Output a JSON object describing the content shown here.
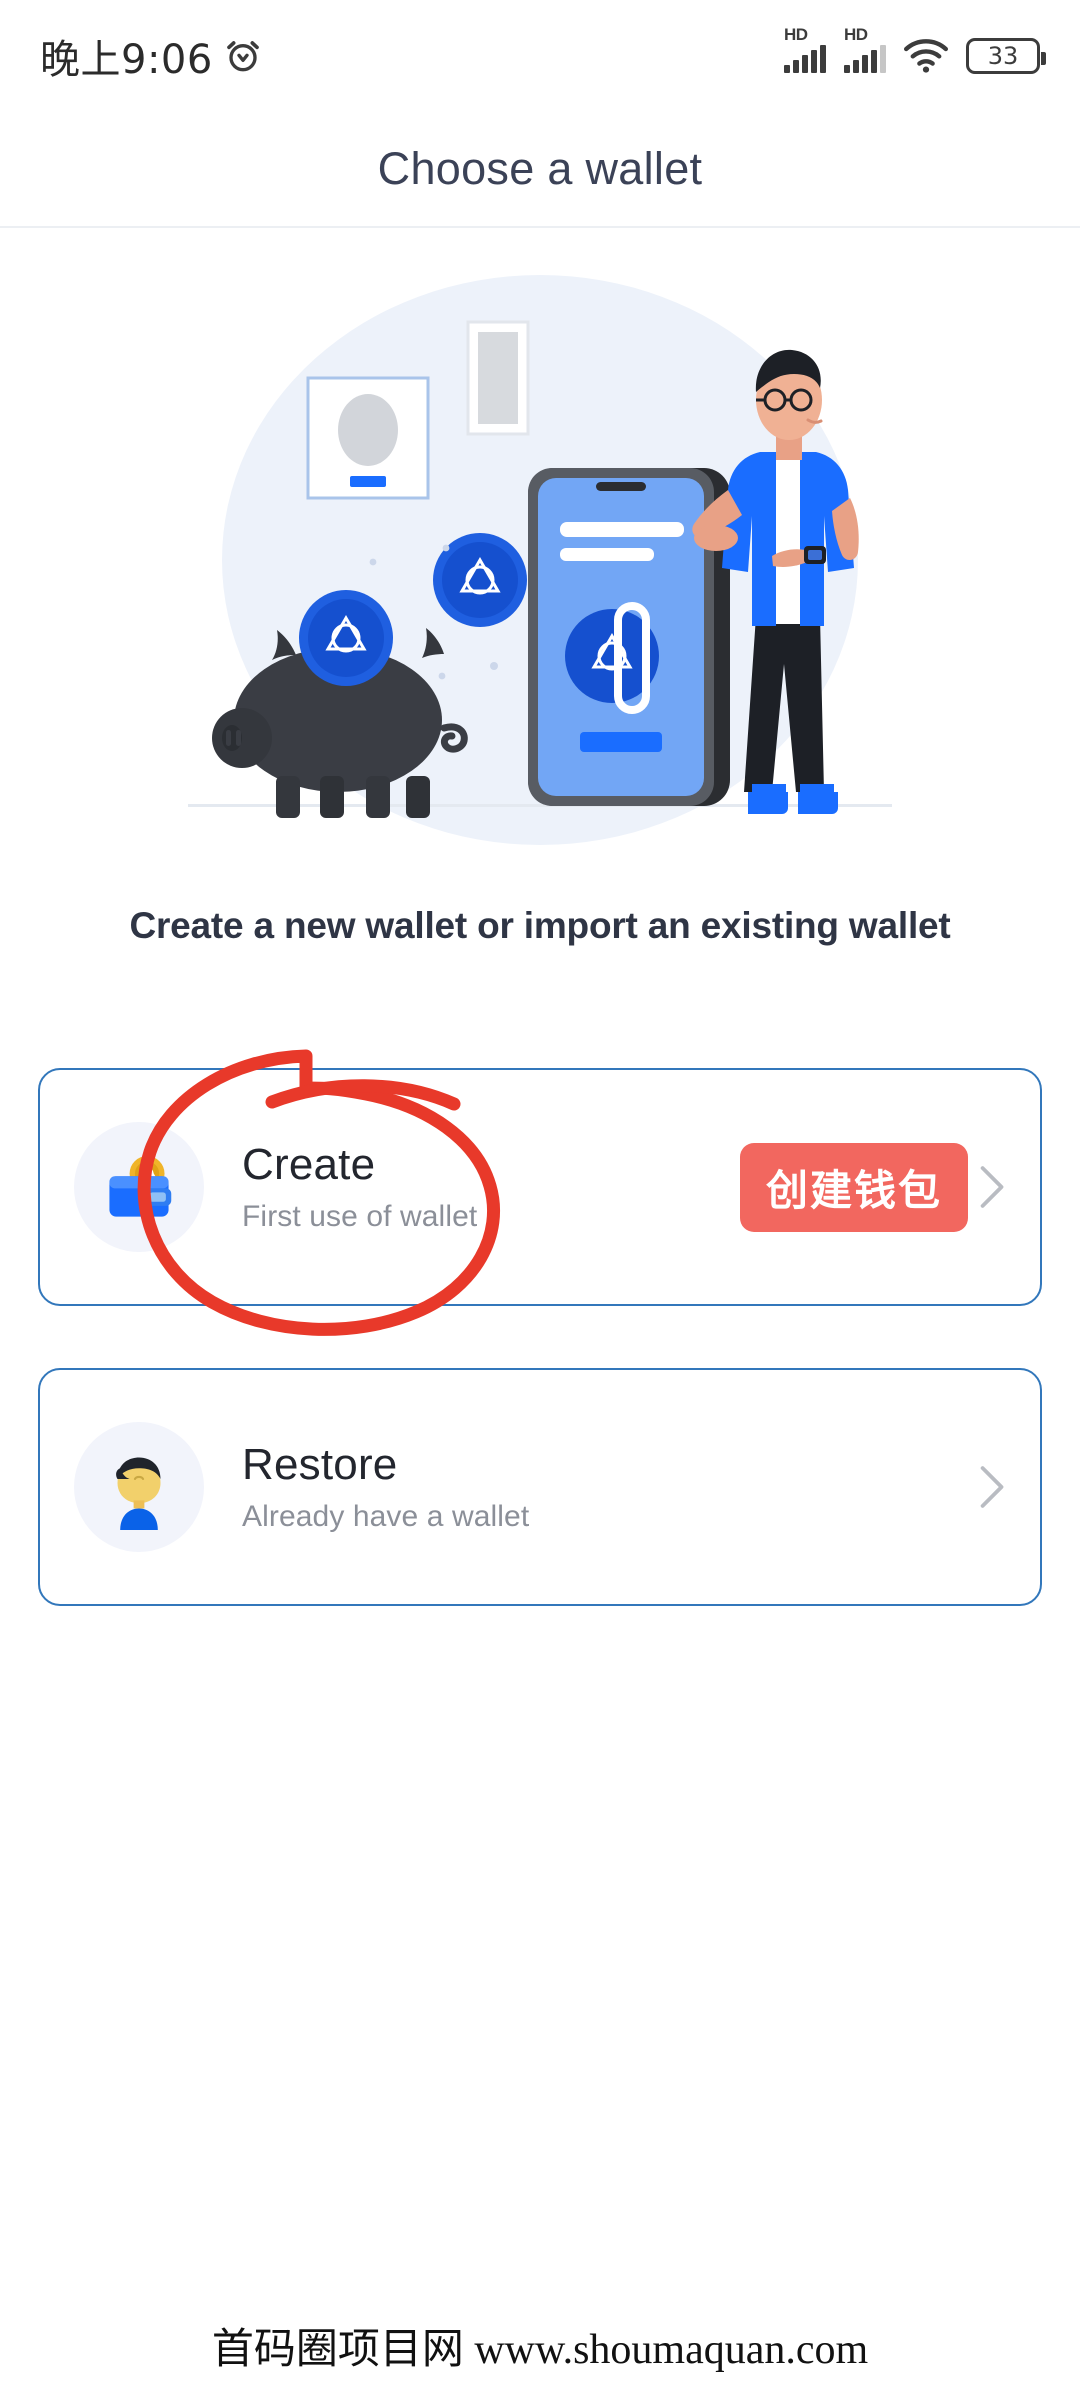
{
  "statusbar": {
    "time": "晚上9:06",
    "alarm_icon": "alarm-clock-icon",
    "signal_1": {
      "icon": "signal-bars-icon",
      "label": "HD"
    },
    "signal_2": {
      "icon": "signal-bars-icon",
      "label": "HD"
    },
    "wifi_icon": "wifi-icon",
    "battery": {
      "icon": "battery-icon",
      "level": "33"
    }
  },
  "header": {
    "title": "Choose a wallet"
  },
  "illustration": {
    "name": "wallet-onboarding-illustration",
    "blob_color": "#edf2fa",
    "coin_color": "#1f5fe0",
    "accent_blue": "#1a6dff",
    "piggy_color": "#3a3d44"
  },
  "main": {
    "subtitle": "Create a new wallet or import an existing wallet",
    "options": [
      {
        "id": "create",
        "icon": "wallet-with-coin-icon",
        "title": "Create",
        "subtitle": "First use of wallet",
        "badge": "创建钱包",
        "badge_color": "#f2675f",
        "chevron": "chevron-right-icon"
      },
      {
        "id": "restore",
        "icon": "user-avatar-icon",
        "title": "Restore",
        "subtitle": "Already have a wallet",
        "badge": null,
        "chevron": "chevron-right-icon"
      }
    ]
  },
  "annotation": {
    "name": "red-circle-highlight",
    "color": "#e8392a",
    "target": "create"
  },
  "watermark": {
    "text": "首码圈项目网 www.shoumaquan.com"
  },
  "colors": {
    "card_border": "#3277bb",
    "title": "#3b4257",
    "accent": "#1a6dff"
  }
}
